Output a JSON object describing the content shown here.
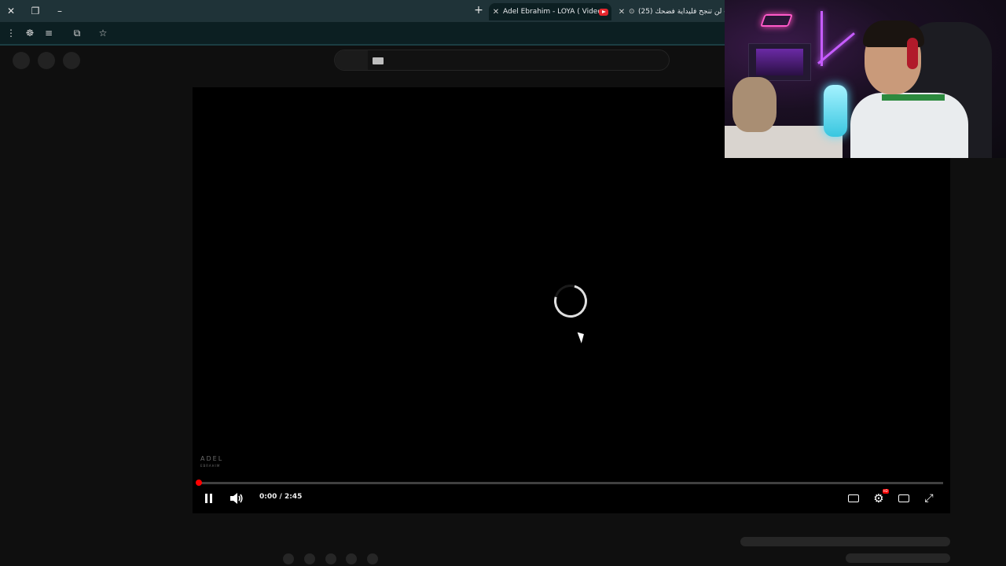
{
  "browser": {
    "window_controls": {
      "close": "✕",
      "restore": "❐",
      "minimize": "–"
    },
    "new_tab": "+",
    "tabs": [
      {
        "title": "Adel Ebrahim - LOYA ( Video Cl",
        "close": "✕",
        "active": true
      },
      {
        "title": "(25) لن تنجح فليداية فضحك -",
        "close": "✕",
        "active": false
      }
    ],
    "toolbar": {
      "menu_icon": "⋮",
      "extension_icon": "☸",
      "queue_icon": "≡",
      "extensions_icon": "⧉",
      "bookmark_icon": "☆"
    }
  },
  "player": {
    "watermark_title": "ADEL",
    "watermark_sub": "EBRAHIM",
    "time": "0:00 / 2:45",
    "progress": 0.0,
    "state": "loading",
    "accent_color": "#ff0000",
    "icons": [
      "pause-icon",
      "volume-icon",
      "subtitles-icon",
      "settings-icon",
      "theater-icon",
      "fullscreen-icon"
    ],
    "settings_badge": "HD"
  },
  "webcam": {
    "description_free": true
  }
}
